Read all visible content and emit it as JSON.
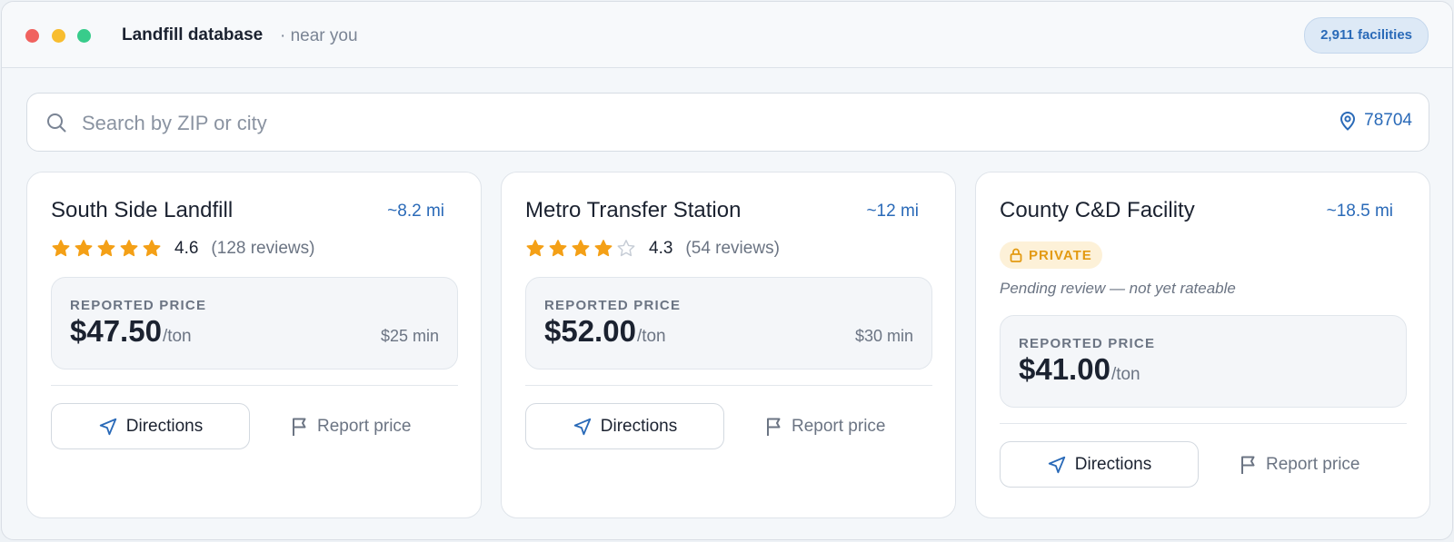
{
  "window": {
    "title": "Landfill database",
    "subtitle": "· near you",
    "facility_count": "2,911 facilities"
  },
  "search": {
    "placeholder": "Search by ZIP or city",
    "value": "",
    "zip": "78704"
  },
  "colors": {
    "accent": "#2a6ab8",
    "star_filled": "#f4a017",
    "star_empty": "#c7cdd6",
    "private_badge_bg": "#fdf1d8",
    "private_badge_text": "#e39a12"
  },
  "facilities": [
    {
      "name": "South Side Landfill",
      "distance": "~8.2 mi",
      "rating": "4.6",
      "stars_filled": 5,
      "reviews": "(128 reviews)",
      "price_label": "REPORTED PRICE",
      "price": "$47.50",
      "unit": "/ton",
      "min": "$25 min",
      "directions_label": "Directions",
      "report_label": "Report price"
    },
    {
      "name": "Metro Transfer Station",
      "distance": "~12 mi",
      "rating": "4.3",
      "stars_filled": 4,
      "reviews": "(54 reviews)",
      "price_label": "REPORTED PRICE",
      "price": "$52.00",
      "unit": "/ton",
      "min": "$30 min",
      "directions_label": "Directions",
      "report_label": "Report price"
    },
    {
      "name": "County C&D Facility",
      "distance": "~18.5 mi",
      "badge": "PRIVATE",
      "badge_icon": "lock-icon",
      "pending_note": "Pending review — not yet rateable",
      "price_label": "REPORTED PRICE",
      "price": "$41.00",
      "unit": "/ton",
      "directions_label": "Directions",
      "report_label": "Report price"
    }
  ]
}
